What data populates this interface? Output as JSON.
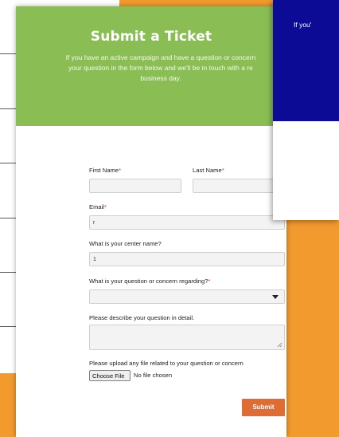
{
  "form": {
    "title": "Submit a Ticket",
    "subtitle_lines": [
      "If you have an active campaign and have a question or concern",
      "your question in the form below and we'll be in touch with a re",
      "business day."
    ],
    "first_name": {
      "label": "First Name",
      "required_mark": "*",
      "value": ""
    },
    "last_name": {
      "label": "Last Name",
      "required_mark": "*",
      "value": ""
    },
    "email": {
      "label": "Email",
      "required_mark": "*",
      "value": "r"
    },
    "center_name": {
      "label": "What is your center name?",
      "value": "1"
    },
    "concern": {
      "label": "What is your question or concern regarding?",
      "required_mark": "*",
      "selected": ""
    },
    "description": {
      "label": "Please describe your question in detail.",
      "value": ""
    },
    "upload": {
      "label": "Please upload any file related to your question or concern",
      "button": "Choose File",
      "status": "No file chosen"
    },
    "submit_label": "Submit"
  },
  "overlay": {
    "text": "If you'"
  },
  "colors": {
    "header": "#8bbd55",
    "submit": "#dd6d35",
    "overlay": "#0b0b96",
    "background": "#f29a2e"
  },
  "icons": {
    "dropdown": "caret-down-icon"
  }
}
